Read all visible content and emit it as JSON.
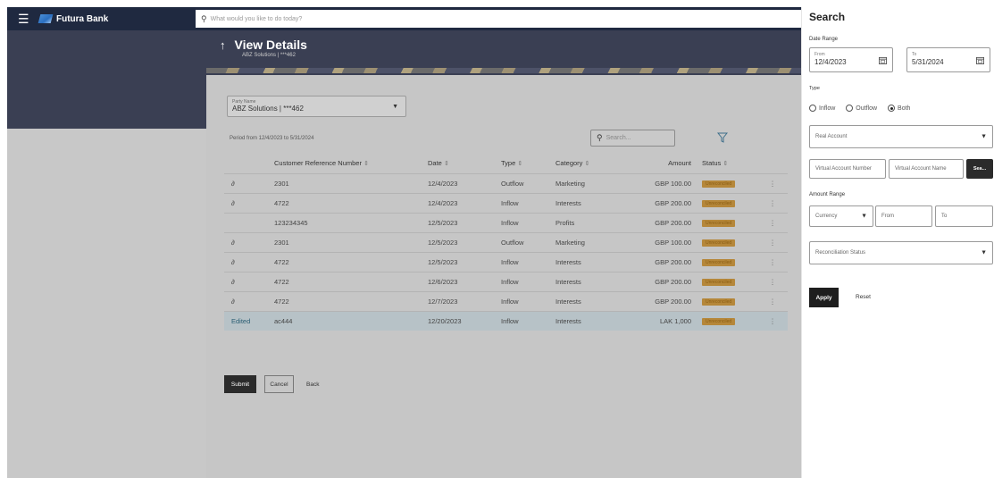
{
  "header": {
    "brand": "Futura Bank",
    "search_placeholder": "What would you like to do today?"
  },
  "hero": {
    "title": "View Details",
    "subtitle": "ABZ Solutions | ***462"
  },
  "party": {
    "label": "Party Name",
    "value": "ABZ Solutions | ***462"
  },
  "period": "Period from 12/4/2023 to 5/31/2024",
  "table_search_placeholder": "Search...",
  "table": {
    "columns": {
      "ref": "Customer Reference Number",
      "date": "Date",
      "type": "Type",
      "category": "Category",
      "amount": "Amount",
      "status": "Status"
    },
    "rows": [
      {
        "icon": "∂",
        "ref": "2301",
        "date": "12/4/2023",
        "type": "Outflow",
        "category": "Marketing",
        "amount": "GBP 100.00",
        "status": "Unreconciled"
      },
      {
        "icon": "∂",
        "ref": "4722",
        "date": "12/4/2023",
        "type": "Inflow",
        "category": "Interests",
        "amount": "GBP 200.00",
        "status": "Unreconciled"
      },
      {
        "icon": "",
        "ref": "123234345",
        "date": "12/5/2023",
        "type": "Inflow",
        "category": "Profits",
        "amount": "GBP 200.00",
        "status": "Unreconciled"
      },
      {
        "icon": "∂",
        "ref": "2301",
        "date": "12/5/2023",
        "type": "Outflow",
        "category": "Marketing",
        "amount": "GBP 100.00",
        "status": "Unreconciled"
      },
      {
        "icon": "∂",
        "ref": "4722",
        "date": "12/5/2023",
        "type": "Inflow",
        "category": "Interests",
        "amount": "GBP 200.00",
        "status": "Unreconciled"
      },
      {
        "icon": "∂",
        "ref": "4722",
        "date": "12/6/2023",
        "type": "Inflow",
        "category": "Interests",
        "amount": "GBP 200.00",
        "status": "Unreconciled"
      },
      {
        "icon": "∂",
        "ref": "4722",
        "date": "12/7/2023",
        "type": "Inflow",
        "category": "Interests",
        "amount": "GBP 200.00",
        "status": "Unreconciled"
      },
      {
        "icon": "Edited",
        "ref": "ac444",
        "date": "12/20/2023",
        "type": "Inflow",
        "category": "Interests",
        "amount": "LAK 1,000",
        "status": "Unreconciled"
      }
    ]
  },
  "actions": {
    "submit": "Submit",
    "cancel": "Cancel",
    "back": "Back"
  },
  "panel": {
    "title": "Search",
    "date_range_label": "Date Range",
    "from_label": "From",
    "from_value": "12/4/2023",
    "to_label": "To",
    "to_value": "5/31/2024",
    "type_label": "Type",
    "type_options": [
      "Inflow",
      "Outflow",
      "Both"
    ],
    "type_selected": "Both",
    "real_account_placeholder": "Real Account",
    "virtual_number_placeholder": "Virtual Account Number",
    "virtual_name_placeholder": "Virtual Account Name",
    "search_button": "Sea...",
    "amount_range_label": "Amount Range",
    "currency_placeholder": "Currency",
    "amount_from_placeholder": "From",
    "amount_to_placeholder": "To",
    "recon_status_placeholder": "Reconciliation Status",
    "apply": "Apply",
    "reset": "Reset"
  }
}
